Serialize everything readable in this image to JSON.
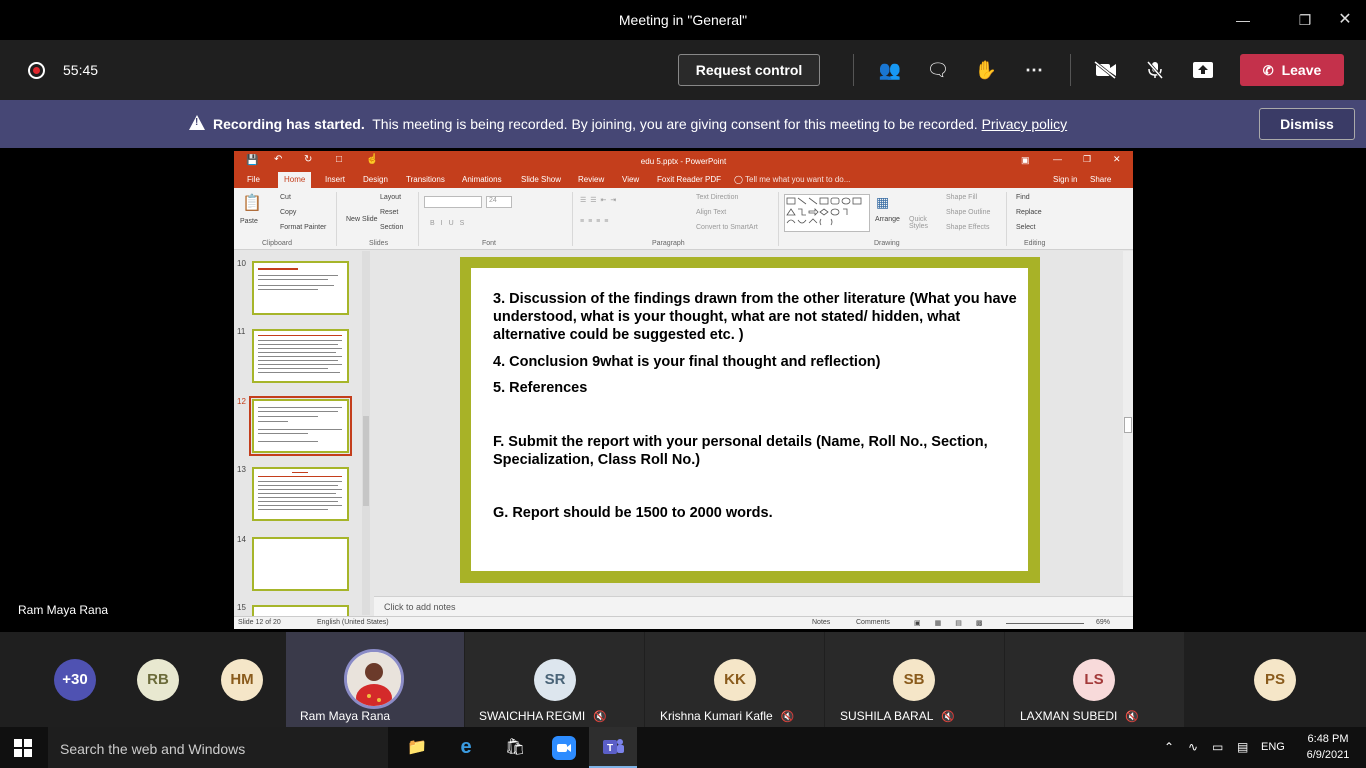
{
  "window": {
    "title": "Meeting in \"General\""
  },
  "toolbar": {
    "timer": "55:45",
    "request_control_label": "Request control",
    "leave_label": "Leave"
  },
  "banner": {
    "bold": "Recording has started.",
    "text": "This meeting is being recorded. By joining, you are giving consent for this meeting to be recorded.",
    "link": "Privacy policy",
    "dismiss_label": "Dismiss"
  },
  "powerpoint": {
    "title": "edu 5.pptx - PowerPoint",
    "tabs": [
      "File",
      "Home",
      "Insert",
      "Design",
      "Transitions",
      "Animations",
      "Slide Show",
      "Review",
      "View",
      "Foxit Reader PDF"
    ],
    "tell_me": "Tell me what you want to do...",
    "sign_in": "Sign in",
    "share": "Share",
    "ribbon": {
      "paste": "Paste",
      "cut": "Cut",
      "copy": "Copy",
      "format_painter": "Format Painter",
      "new_slide": "New Slide",
      "layout": "Layout",
      "reset": "Reset",
      "section": "Section",
      "font_size": "24",
      "text_direction": "Text Direction",
      "align_text": "Align Text",
      "convert_smartart": "Convert to SmartArt",
      "arrange": "Arrange",
      "quick_styles": "Quick Styles",
      "shape_fill": "Shape Fill",
      "shape_outline": "Shape Outline",
      "shape_effects": "Shape Effects",
      "find": "Find",
      "replace": "Replace",
      "select": "Select",
      "groups": [
        "Clipboard",
        "Slides",
        "Font",
        "Paragraph",
        "Drawing",
        "Editing"
      ]
    },
    "thumb_numbers": [
      "10",
      "11",
      "12",
      "13",
      "14",
      "15"
    ],
    "slide_lines": [
      " 3. Discussion of the findings drawn from the other literature (What you have understood, what is your thought, what are not stated/ hidden, what alternative could be suggested etc. )",
      "4. Conclusion 9what is your final thought and reflection)",
      "5. References",
      "F.  Submit the report with your personal details (Name, Roll No., Section, Specialization, Class Roll No.)",
      "G. Report should be 1500 to 2000 words."
    ],
    "notes_placeholder": "Click to add notes",
    "status": {
      "slide": "Slide 12 of 20",
      "language": "English (United States)",
      "notes": "Notes",
      "comments": "Comments",
      "zoom": "69%"
    }
  },
  "presenter_name": "Ram Maya Rana",
  "participants": [
    {
      "initials": "+30",
      "color": "#4f52b2",
      "text_color": "#ffffff"
    },
    {
      "initials": "RB",
      "color": "#e8e8d0",
      "text_color": "#6b6b3a"
    },
    {
      "initials": "HM",
      "color": "#f5e6c8",
      "text_color": "#8a5b1c"
    },
    {
      "initials": "",
      "name": "Ram Maya Rana"
    },
    {
      "initials": "SR",
      "color": "#dde6ee",
      "text_color": "#4a6478",
      "name": "SWAICHHA REGMI"
    },
    {
      "initials": "KK",
      "color": "#f5e6c8",
      "text_color": "#8a5b1c",
      "name": "Krishna Kumari Kafle"
    },
    {
      "initials": "SB",
      "color": "#f5e6c8",
      "text_color": "#8a5b1c",
      "name": "SUSHILA BARAL"
    },
    {
      "initials": "LS",
      "color": "#f8dada",
      "text_color": "#a33a3a",
      "name": "LAXMAN SUBEDI"
    },
    {
      "initials": "PS",
      "color": "#f5e6c8",
      "text_color": "#8a5b1c"
    }
  ],
  "taskbar": {
    "search_placeholder": "Search the web and Windows",
    "language": "ENG",
    "time": "6:48 PM",
    "date": "6/9/2021"
  }
}
